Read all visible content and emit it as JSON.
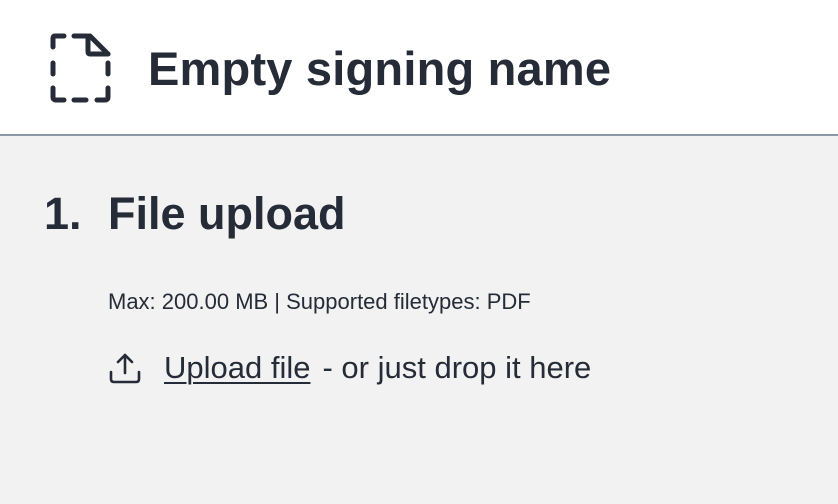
{
  "header": {
    "icon": "file-dashed-icon",
    "title": "Empty signing name"
  },
  "step": {
    "number": "1.",
    "title": "File upload",
    "limits": "Max: 200.00 MB | Supported filetypes: PDF",
    "upload_icon": "upload-icon",
    "upload_link": "Upload file",
    "drop_hint": "- or just drop it here"
  },
  "colors": {
    "text": "#252b37",
    "header_bg": "#ffffff",
    "main_bg": "#f2f2f2",
    "divider": "#8b98a6"
  }
}
